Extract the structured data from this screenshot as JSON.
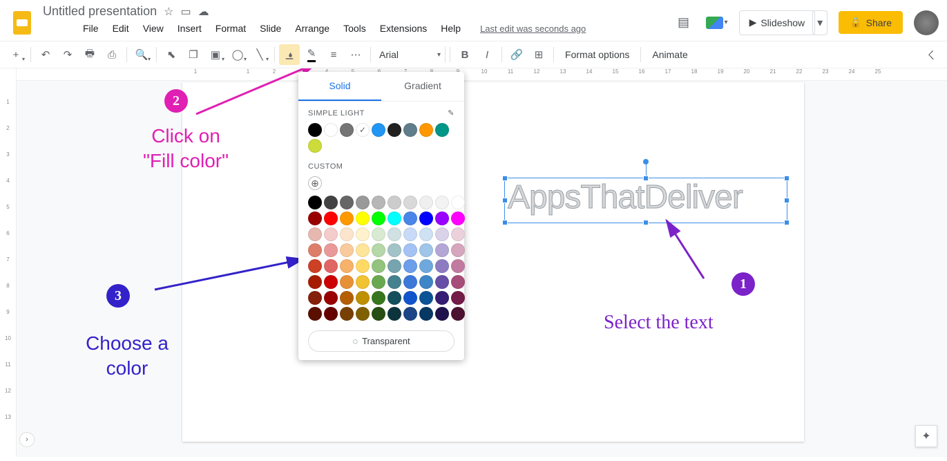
{
  "header": {
    "title": "Untitled presentation",
    "slideshow": "Slideshow",
    "share": "Share"
  },
  "menu": {
    "file": "File",
    "edit": "Edit",
    "view": "View",
    "insert": "Insert",
    "format": "Format",
    "slide": "Slide",
    "arrange": "Arrange",
    "tools": "Tools",
    "extensions": "Extensions",
    "help": "Help",
    "last_edit": "Last edit was seconds ago"
  },
  "toolbar": {
    "font": "Arial",
    "format_options": "Format options",
    "animate": "Animate"
  },
  "popup": {
    "tab_solid": "Solid",
    "tab_gradient": "Gradient",
    "theme_label": "SIMPLE LIGHT",
    "custom_label": "CUSTOM",
    "transparent": "Transparent",
    "theme_colors": [
      "#000000",
      "#ffffff",
      "#757575",
      "#ffffff",
      "#2196f3",
      "#212121",
      "#607d8b",
      "#ff9800",
      "#009688",
      "#cddc39"
    ],
    "palette": [
      "#000000",
      "#434343",
      "#666666",
      "#999999",
      "#b7b7b7",
      "#cccccc",
      "#d9d9d9",
      "#efefef",
      "#f3f3f3",
      "#ffffff",
      "#980000",
      "#ff0000",
      "#ff9900",
      "#ffff00",
      "#00ff00",
      "#00ffff",
      "#4a86e8",
      "#0000ff",
      "#9900ff",
      "#ff00ff",
      "#e6b8af",
      "#f4cccc",
      "#fce5cd",
      "#fff2cc",
      "#d9ead3",
      "#d0e0e3",
      "#c9daf8",
      "#cfe2f3",
      "#d9d2e9",
      "#ead1dc",
      "#dd7e6b",
      "#ea9999",
      "#f9cb9c",
      "#ffe599",
      "#b6d7a8",
      "#a2c4c9",
      "#a4c2f4",
      "#9fc5e8",
      "#b4a7d6",
      "#d5a6bd",
      "#cc4125",
      "#e06666",
      "#f6b26b",
      "#ffd966",
      "#93c47d",
      "#76a5af",
      "#6d9eeb",
      "#6fa8dc",
      "#8e7cc3",
      "#c27ba0",
      "#a61c00",
      "#cc0000",
      "#e69138",
      "#f1c232",
      "#6aa84f",
      "#45818e",
      "#3c78d8",
      "#3d85c6",
      "#674ea7",
      "#a64d79",
      "#85200c",
      "#990000",
      "#b45f06",
      "#bf9000",
      "#38761d",
      "#134f5c",
      "#1155cc",
      "#0b5394",
      "#351c75",
      "#741b47",
      "#5b0f00",
      "#660000",
      "#783f04",
      "#7f6000",
      "#274e13",
      "#0c343d",
      "#1c4587",
      "#073763",
      "#20124d",
      "#4c1130"
    ]
  },
  "slide": {
    "wordart": "AppsThatDeliver"
  },
  "annotations": {
    "step1_badge": "1",
    "step1_text": "Select the text",
    "step2_badge": "2",
    "step2_text1": "Click on",
    "step2_text2": "\"Fill color\"",
    "step3_badge": "3",
    "step3_text1": "Choose a",
    "step3_text2": "color"
  },
  "ruler_h": [
    "1",
    "",
    "1",
    "2",
    "3",
    "4",
    "5",
    "6",
    "7",
    "8",
    "9",
    "10",
    "11",
    "12",
    "13",
    "14",
    "15",
    "16",
    "17",
    "18",
    "19",
    "20",
    "21",
    "22",
    "23",
    "24",
    "25"
  ],
  "ruler_v": [
    "",
    "1",
    "2",
    "3",
    "4",
    "5",
    "6",
    "7",
    "8",
    "9",
    "10",
    "11",
    "12",
    "13"
  ]
}
